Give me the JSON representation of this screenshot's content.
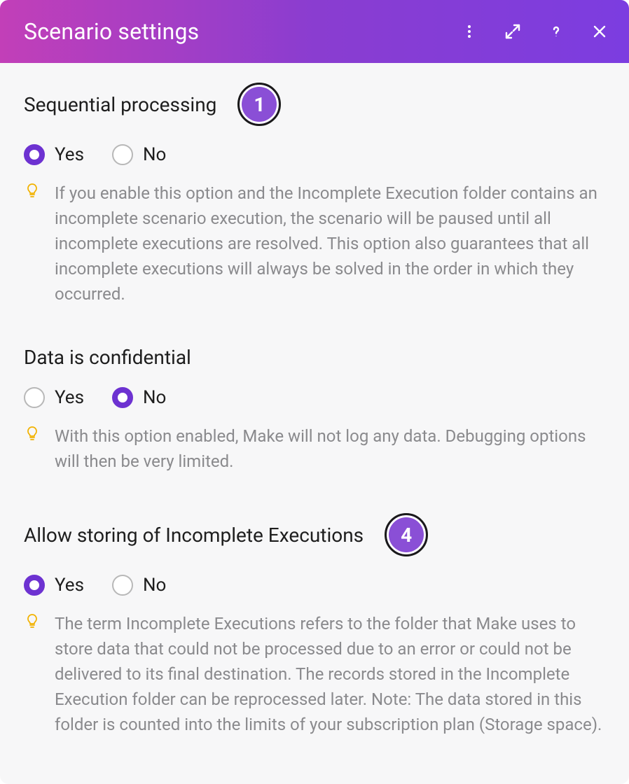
{
  "header": {
    "title": "Scenario settings"
  },
  "colors": {
    "accent": "#6d32d1",
    "badge": "#8a4fd6",
    "hint_icon": "#f2b200"
  },
  "settings": [
    {
      "key": "sequential_processing",
      "title": "Sequential processing",
      "badge": "1",
      "options": {
        "yes": "Yes",
        "no": "No"
      },
      "selected": "yes",
      "hint": "If you enable this option and the Incomplete Execution folder contains an incomplete scenario execution, the scenario will be paused until all incomplete executions are resolved. This option also guarantees that all incomplete executions will always be solved in the order in which they occurred."
    },
    {
      "key": "data_confidential",
      "title": "Data is confidential",
      "badge": null,
      "options": {
        "yes": "Yes",
        "no": "No"
      },
      "selected": "no",
      "hint": "With this option enabled, Make will not log any data. Debugging options will then be very limited."
    },
    {
      "key": "allow_incomplete_executions",
      "title": "Allow storing of Incomplete Executions",
      "badge": "4",
      "options": {
        "yes": "Yes",
        "no": "No"
      },
      "selected": "yes",
      "hint": "The term Incomplete Executions refers to the folder that Make uses to store data that could not be processed due to an error or could not be delivered to its final destination. The records stored in the Incomplete Execution folder can be reprocessed later. Note: The data stored in this folder is counted into the limits of your subscription plan (Storage space)."
    }
  ]
}
